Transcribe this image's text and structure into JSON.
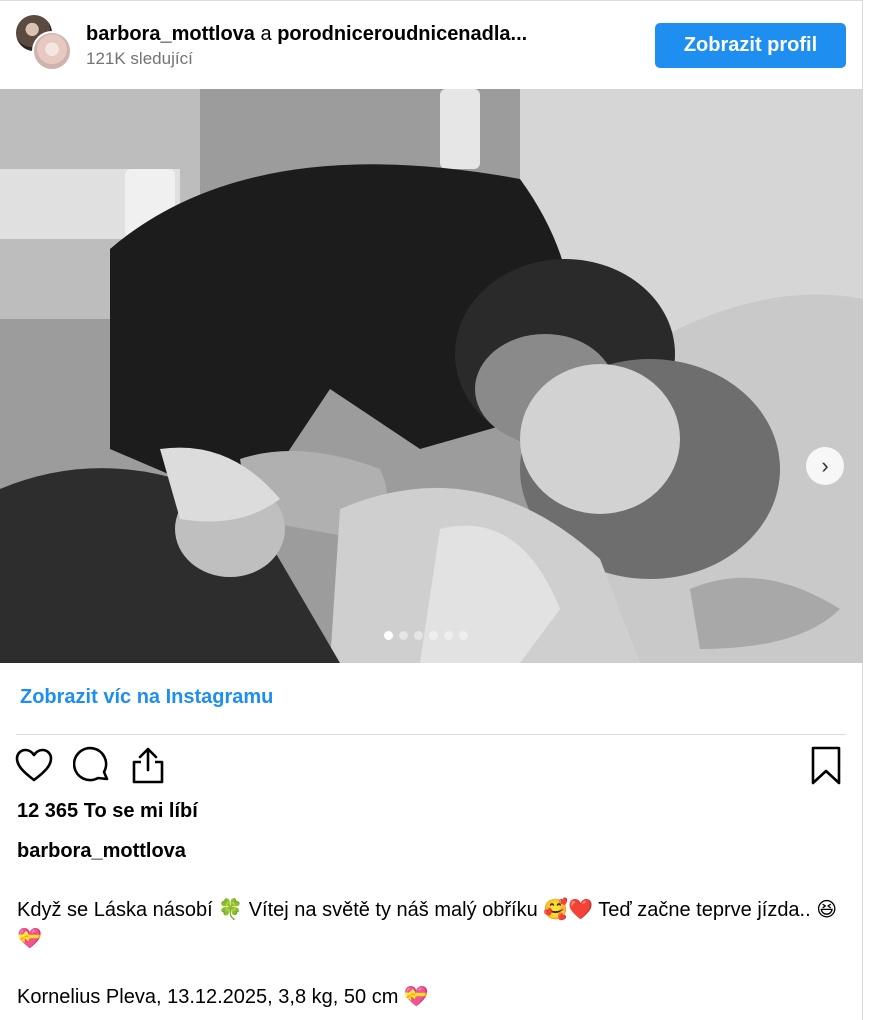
{
  "header": {
    "author": "barbora_mottlova",
    "connector": " a ",
    "coauthor": "porodniceroudnicenadla...",
    "followers": "121K sledující",
    "profile_button": "Zobrazit profil"
  },
  "carousel": {
    "slide_count": 6,
    "active_index": 0,
    "next_icon": "chevron-right-icon"
  },
  "links": {
    "more_on_instagram": "Zobrazit víc na Instagramu"
  },
  "actions": {
    "icons": [
      "heart-icon",
      "comment-icon",
      "share-icon",
      "bookmark-icon"
    ]
  },
  "post": {
    "likes": "12 365 To se mi líbí",
    "caption_user": "barbora_mottlova",
    "caption_line1": "Když se Láska násobí 🍀 Vítej na světě ty náš malý obříku 🥰❤️ Teď začne teprve jízda.. 😆💝",
    "caption_line2": "Kornelius Pleva, 13.12.2025, 3,8 kg, 50 cm 💝"
  },
  "colors": {
    "accent": "#1f8ef1",
    "muted_text": "#737373",
    "divider": "#dbdbdb"
  }
}
